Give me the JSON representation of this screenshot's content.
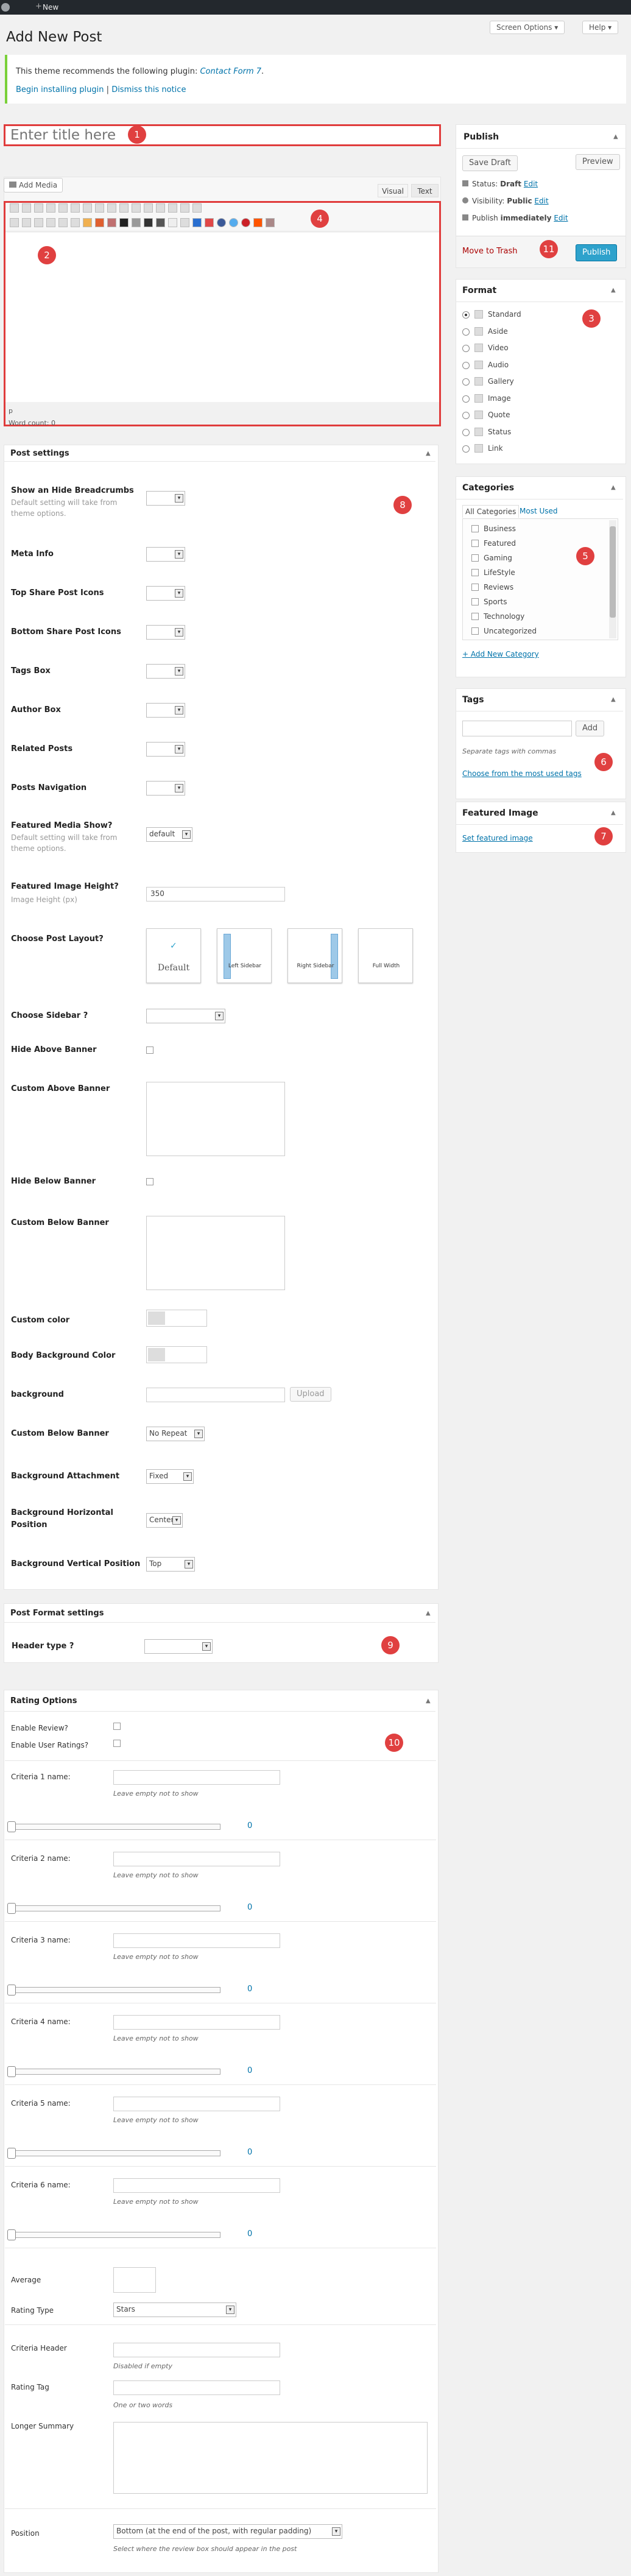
{
  "adminbar": {
    "new_label": "New"
  },
  "page": {
    "title": "Add New Post"
  },
  "header": {
    "screen_options": "Screen Options",
    "help": "Help"
  },
  "notice": {
    "text_prefix": "This theme recommends the following plugin:",
    "plugin": "Contact Form 7",
    "begin_link": "Begin installing plugin",
    "sep": "|",
    "dismiss_link": "Dismiss this notice"
  },
  "title_input": {
    "placeholder": "Enter title here"
  },
  "editor": {
    "add_media": "Add Media",
    "visual_tab": "Visual",
    "text_tab": "Text",
    "path": "p",
    "word_count": "Word count: 0"
  },
  "publish": {
    "heading": "Publish",
    "save_draft": "Save Draft",
    "preview": "Preview",
    "status_label": "Status:",
    "status_value": "Draft",
    "visibility_label": "Visibility:",
    "visibility_value": "Public",
    "publish_label": "Publish",
    "publish_value": "immediately",
    "edit": "Edit",
    "trash": "Move to Trash",
    "publish_btn": "Publish"
  },
  "format": {
    "heading": "Format",
    "options": [
      "Standard",
      "Aside",
      "Video",
      "Audio",
      "Gallery",
      "Image",
      "Quote",
      "Status",
      "Link"
    ]
  },
  "categories": {
    "heading": "Categories",
    "tab_all": "All Categories",
    "tab_most": "Most Used",
    "items": [
      "Business",
      "Featured",
      "Gaming",
      "LifeStyle",
      "Reviews",
      "Sports",
      "Technology",
      "Uncategorized"
    ],
    "add_new": "+ Add New Category"
  },
  "tags": {
    "heading": "Tags",
    "add_btn": "Add",
    "hint": "Separate tags with commas",
    "choose_link": "Choose from the most used tags"
  },
  "featured_image": {
    "heading": "Featured Image",
    "set_link": "Set featured image"
  },
  "post_settings": {
    "heading": "Post settings",
    "breadcrumbs": "Show an Hide Breadcrumbs",
    "default_hint": "Default setting will take from theme options.",
    "meta_info": "Meta Info",
    "top_share": "Top Share Post Icons",
    "bottom_share": "Bottom Share Post Icons",
    "tags_box": "Tags Box",
    "author_box": "Author Box",
    "related": "Related Posts",
    "post_nav": "Posts Navigation",
    "featured_media": "Featured Media Show?",
    "featured_media_value": "default",
    "featured_height": "Featured Image Height?",
    "featured_height_hint": "Image Height (px)",
    "featured_height_value": "350",
    "layout": "Choose Post Layout?",
    "layout_options": [
      "Default",
      "Left Sidebar",
      "Right Sidebar",
      "Full Width"
    ],
    "sidebar": "Choose Sidebar ?",
    "hide_above": "Hide Above Banner",
    "custom_above": "Custom Above Banner",
    "hide_below": "Hide Below Banner",
    "custom_below": "Custom Below Banner",
    "custom_color": "Custom color",
    "body_bg": "Body Background Color",
    "background": "background",
    "upload": "Upload",
    "custom_below_banner": "Custom Below Banner",
    "no_repeat": "No Repeat",
    "bg_attachment": "Background Attachment",
    "fixed": "Fixed",
    "bg_horizontal": "Background Horizontal Position",
    "center": "Center",
    "bg_vertical": "Background Vertical Position",
    "top": "Top"
  },
  "post_format_settings": {
    "heading": "Post Format settings",
    "header_type": "Header type ?"
  },
  "rating": {
    "heading": "Rating Options",
    "enable_review": "Enable Review?",
    "enable_user": "Enable User Ratings?",
    "criteria": [
      {
        "label": "Criteria 1 name:",
        "value": "0"
      },
      {
        "label": "Criteria 2 name:",
        "value": "0"
      },
      {
        "label": "Criteria 3 name:",
        "value": "0"
      },
      {
        "label": "Criteria 4 name:",
        "value": "0"
      },
      {
        "label": "Criteria 5 name:",
        "value": "0"
      },
      {
        "label": "Criteria 6 name:",
        "value": "0"
      }
    ],
    "leave_empty": "Leave empty not to show",
    "average": "Average",
    "rating_type": "Rating Type",
    "rating_type_value": "Stars",
    "criteria_header": "Criteria Header",
    "disabled_hint": "Disabled if empty",
    "rating_tag": "Rating Tag",
    "tag_hint": "One or two words",
    "longer_summary": "Longer Summary",
    "position": "Position",
    "position_value": "Bottom (at the end of the post, with regular padding)",
    "position_hint": "Select where the review box should appear in the post"
  },
  "badges": [
    "1",
    "2",
    "3",
    "4",
    "5",
    "6",
    "7",
    "8",
    "9",
    "10",
    "11"
  ]
}
